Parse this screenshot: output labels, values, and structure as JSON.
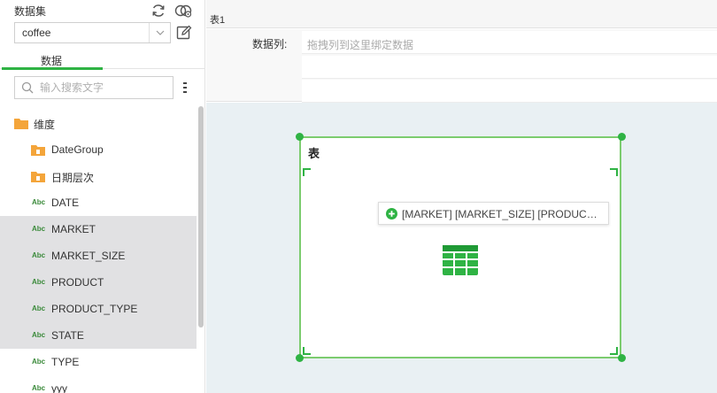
{
  "colors": {
    "accent": "#2fb344",
    "folder": "#f4a53a",
    "selected_row_bg": "#e1e1e3",
    "canvas_bg": "#e9f0f3",
    "abc_icon": "#3a8a3a"
  },
  "left_panel": {
    "title": "数据集",
    "icons": [
      "refresh-icon",
      "link-icon",
      "edit-icon"
    ],
    "dataset_select": {
      "value": "coffee"
    },
    "tab": {
      "label": "数据"
    },
    "search": {
      "placeholder": "输入搜索文字",
      "value": ""
    },
    "tree": [
      {
        "label": "维度",
        "icon": "folder-icon",
        "level": 0,
        "selected": false
      },
      {
        "label": "DateGroup",
        "icon": "folder-icon",
        "level": 1,
        "selected": false
      },
      {
        "label": "日期层次",
        "icon": "folder-icon",
        "level": 1,
        "selected": false
      },
      {
        "label": "DATE",
        "icon": "abc-icon",
        "level": 1,
        "selected": false
      },
      {
        "label": "MARKET",
        "icon": "abc-icon",
        "level": 1,
        "selected": true
      },
      {
        "label": "MARKET_SIZE",
        "icon": "abc-icon",
        "level": 1,
        "selected": true
      },
      {
        "label": "PRODUCT",
        "icon": "abc-icon",
        "level": 1,
        "selected": true
      },
      {
        "label": "PRODUCT_TYPE",
        "icon": "abc-icon",
        "level": 1,
        "selected": true
      },
      {
        "label": "STATE",
        "icon": "abc-icon",
        "level": 1,
        "selected": true
      },
      {
        "label": "TYPE",
        "icon": "abc-icon",
        "level": 1,
        "selected": false
      },
      {
        "label": "yyy",
        "icon": "abc-icon",
        "level": 1,
        "selected": false
      }
    ],
    "abc_text": "Abc"
  },
  "sheet_tab": {
    "label": "表1"
  },
  "binding": {
    "label": "数据列:",
    "placeholder": "拖拽列到这里绑定数据"
  },
  "widget": {
    "title": "表",
    "drop_tooltip": "[MARKET] [MARKET_SIZE] [PRODUC…",
    "body_icon": "table-icon"
  }
}
